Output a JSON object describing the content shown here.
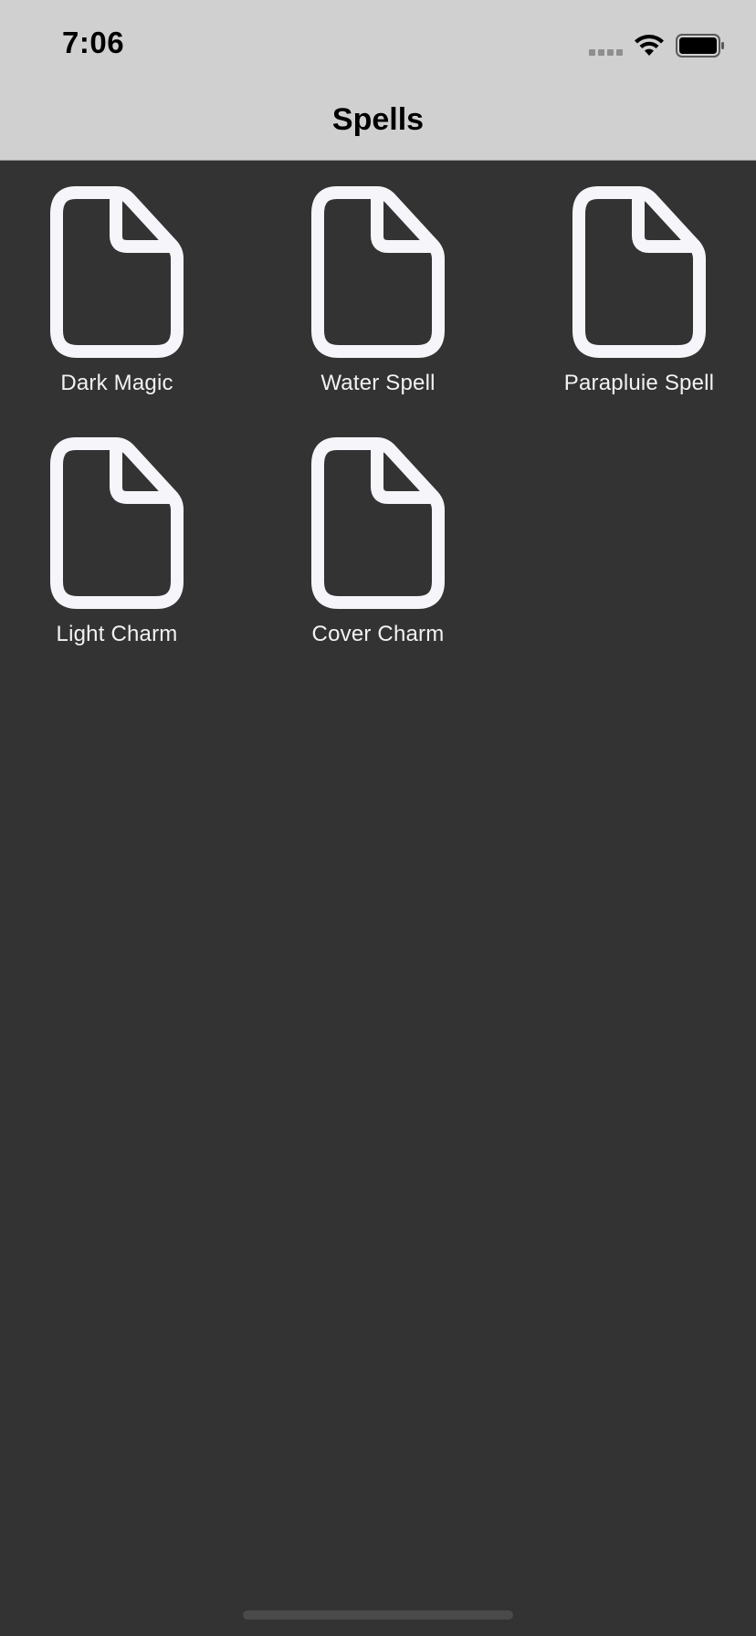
{
  "status_bar": {
    "time": "7:06",
    "icons": [
      "cellular-signal-icon",
      "wifi-icon",
      "battery-icon"
    ]
  },
  "nav": {
    "title": "Spells"
  },
  "files": [
    {
      "name": "Dark Magic",
      "icon": "document-icon"
    },
    {
      "name": "Water Spell",
      "icon": "document-icon"
    },
    {
      "name": "Parapluie Spell",
      "icon": "document-icon"
    },
    {
      "name": "Light Charm",
      "icon": "document-icon"
    },
    {
      "name": "Cover Charm",
      "icon": "document-icon"
    }
  ],
  "colors": {
    "background": "#333333",
    "header": "#d0d0d0",
    "icon_stroke": "#f5f5fa",
    "label_text": "#f2f2f2"
  }
}
